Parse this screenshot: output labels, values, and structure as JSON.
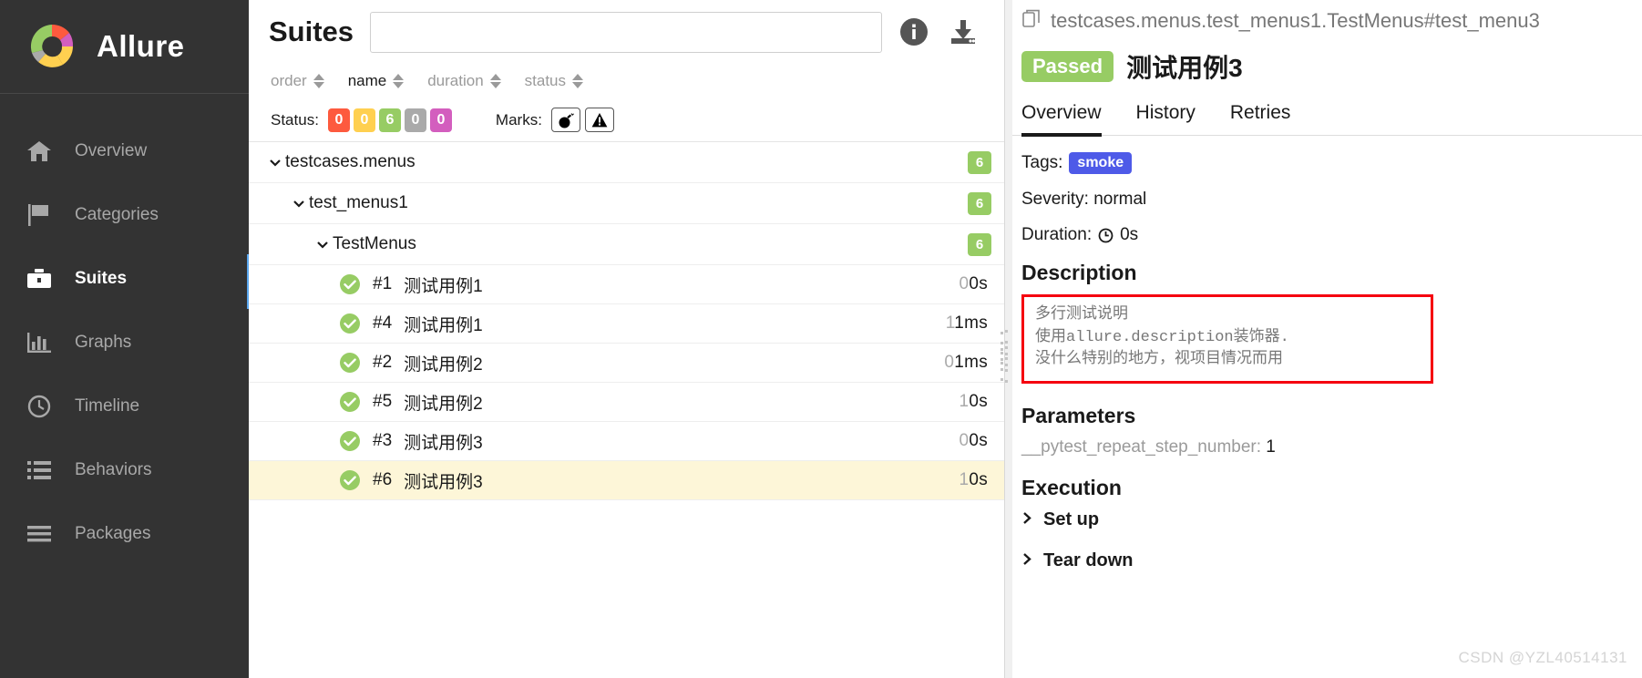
{
  "sidebar": {
    "brand": "Allure",
    "items": [
      {
        "label": "Overview",
        "icon": "home-icon",
        "active": false
      },
      {
        "label": "Categories",
        "icon": "flag-icon",
        "active": false
      },
      {
        "label": "Suites",
        "icon": "briefcase-icon",
        "active": true
      },
      {
        "label": "Graphs",
        "icon": "bar-chart-icon",
        "active": false
      },
      {
        "label": "Timeline",
        "icon": "clock-icon",
        "active": false
      },
      {
        "label": "Behaviors",
        "icon": "list-icon",
        "active": false
      },
      {
        "label": "Packages",
        "icon": "stack-icon",
        "active": false
      }
    ]
  },
  "middle": {
    "title": "Suites",
    "search": {
      "value": "",
      "placeholder": ""
    },
    "header_icons": [
      {
        "name": "info-icon"
      },
      {
        "name": "download-icon"
      }
    ],
    "sort": [
      {
        "label": "order",
        "active": false
      },
      {
        "label": "name",
        "active": true
      },
      {
        "label": "duration",
        "active": false
      },
      {
        "label": "status",
        "active": false
      }
    ],
    "status_label": "Status:",
    "status_badges": [
      {
        "count": "0",
        "color": "#fd5a3e",
        "name": "failed"
      },
      {
        "count": "0",
        "color": "#ffd050",
        "name": "broken"
      },
      {
        "count": "6",
        "color": "#97cc64",
        "name": "passed"
      },
      {
        "count": "0",
        "color": "#aaaaaa",
        "name": "skipped"
      },
      {
        "count": "0",
        "color": "#d35ebe",
        "name": "unknown"
      }
    ],
    "marks_label": "Marks:",
    "marks": [
      {
        "name": "flaky-bomb-icon"
      },
      {
        "name": "warning-triangle-icon"
      }
    ],
    "tree": [
      {
        "type": "group",
        "level": 0,
        "name": "testcases.menus",
        "count": "6"
      },
      {
        "type": "group",
        "level": 1,
        "name": "test_menus1",
        "count": "6"
      },
      {
        "type": "group",
        "level": 2,
        "name": "TestMenus",
        "count": "6"
      },
      {
        "type": "case",
        "level": 3,
        "num": "#1",
        "name": "测试用例1",
        "dur_dim": "0",
        "dur_val": "0s",
        "status": "passed",
        "selected": false
      },
      {
        "type": "case",
        "level": 3,
        "num": "#4",
        "name": "测试用例1",
        "dur_dim": "1",
        "dur_val": "1ms",
        "status": "passed",
        "selected": false
      },
      {
        "type": "case",
        "level": 3,
        "num": "#2",
        "name": "测试用例2",
        "dur_dim": "0",
        "dur_val": "1ms",
        "status": "passed",
        "selected": false
      },
      {
        "type": "case",
        "level": 3,
        "num": "#5",
        "name": "测试用例2",
        "dur_dim": "1",
        "dur_val": "0s",
        "status": "passed",
        "selected": false
      },
      {
        "type": "case",
        "level": 3,
        "num": "#3",
        "name": "测试用例3",
        "dur_dim": "0",
        "dur_val": "0s",
        "status": "passed",
        "selected": false
      },
      {
        "type": "case",
        "level": 3,
        "num": "#6",
        "name": "测试用例3",
        "dur_dim": "1",
        "dur_val": "0s",
        "status": "passed",
        "selected": true
      }
    ]
  },
  "detail": {
    "path": "testcases.menus.test_menus1.TestMenus#test_menu3",
    "status_pill": "Passed",
    "status_color": "#97cc64",
    "title": "测试用例3",
    "tabs": [
      {
        "label": "Overview",
        "active": true
      },
      {
        "label": "History",
        "active": false
      },
      {
        "label": "Retries",
        "active": false
      }
    ],
    "tags_label": "Tags:",
    "tags": [
      {
        "label": "smoke",
        "color": "#4e5ae8"
      }
    ],
    "severity": "Severity: normal",
    "duration_label": "Duration:",
    "duration_value": "0s",
    "description_heading": "Description",
    "description_lines": [
      "多行测试说明",
      "使用allure.description装饰器.",
      "没什么特别的地方，视项目情况而用"
    ],
    "description_border_color": "#f5000f",
    "parameters_heading": "Parameters",
    "parameters": [
      {
        "key": "__pytest_repeat_step_number",
        "value": "1"
      }
    ],
    "execution_heading": "Execution",
    "execution_items": [
      {
        "label": "Set up"
      },
      {
        "label": "Tear down"
      }
    ]
  },
  "watermark": "CSDN @YZL40514131"
}
